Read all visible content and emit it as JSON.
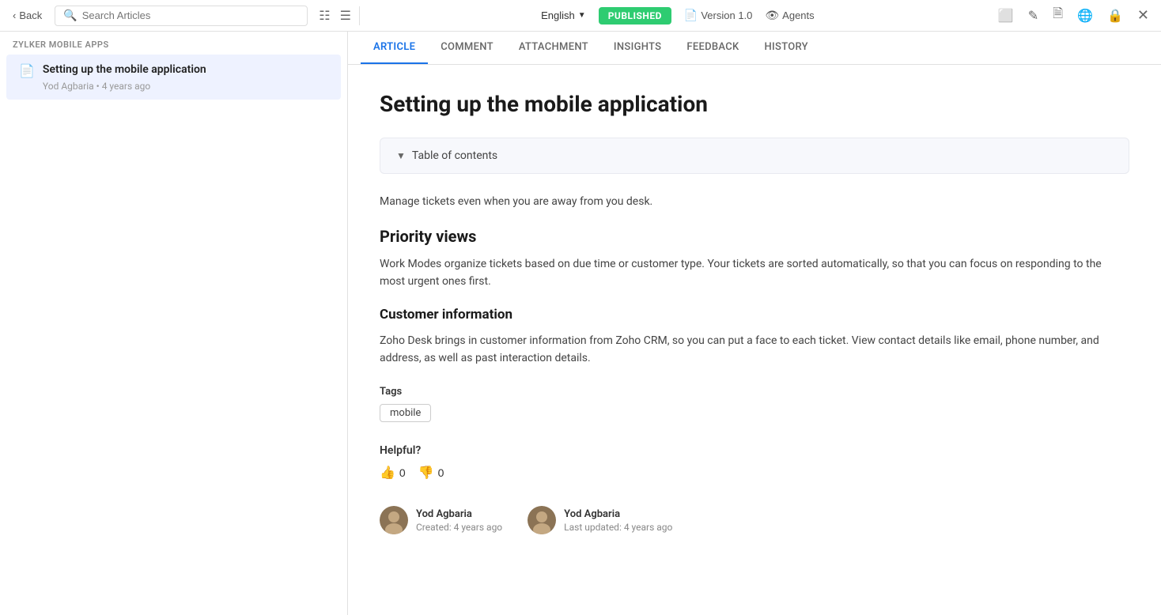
{
  "topbar": {
    "back_label": "Back",
    "search_placeholder": "Search Articles",
    "language": "English",
    "published_label": "PUBLISHED",
    "version_label": "Version 1.0",
    "agents_label": "Agents"
  },
  "sidebar": {
    "category": "Zylker Mobile apps",
    "articles": [
      {
        "title": "Setting up the mobile application",
        "author": "Yod Agbaria",
        "time_ago": "4 years ago"
      }
    ]
  },
  "tabs": [
    {
      "label": "ARTICLE",
      "active": true
    },
    {
      "label": "COMMENT",
      "active": false
    },
    {
      "label": "ATTACHMENT",
      "active": false
    },
    {
      "label": "INSIGHTS",
      "active": false
    },
    {
      "label": "FEEDBACK",
      "active": false
    },
    {
      "label": "HISTORY",
      "active": false
    }
  ],
  "article": {
    "title": "Setting up the mobile application",
    "toc_label": "Table of contents",
    "intro": "Manage tickets even when you are away from you desk.",
    "section1_title": "Priority views",
    "section1_body": "Work Modes organize tickets based on due time or customer type. Your tickets are sorted automatically, so that you can focus on responding to the most urgent ones first.",
    "section2_title": "Customer information",
    "section2_body": "Zoho Desk brings in customer information from Zoho CRM, so you can put a face to each ticket. View contact details like email, phone number, and address, as well as past interaction details.",
    "tags_label": "Tags",
    "tag": "mobile",
    "helpful_label": "Helpful?",
    "thumbs_up_count": "0",
    "thumbs_down_count": "0",
    "author1_name": "Yod Agbaria",
    "author1_sub": "Created: 4 years ago",
    "author2_name": "Yod Agbaria",
    "author2_sub": "Last updated: 4 years ago"
  }
}
